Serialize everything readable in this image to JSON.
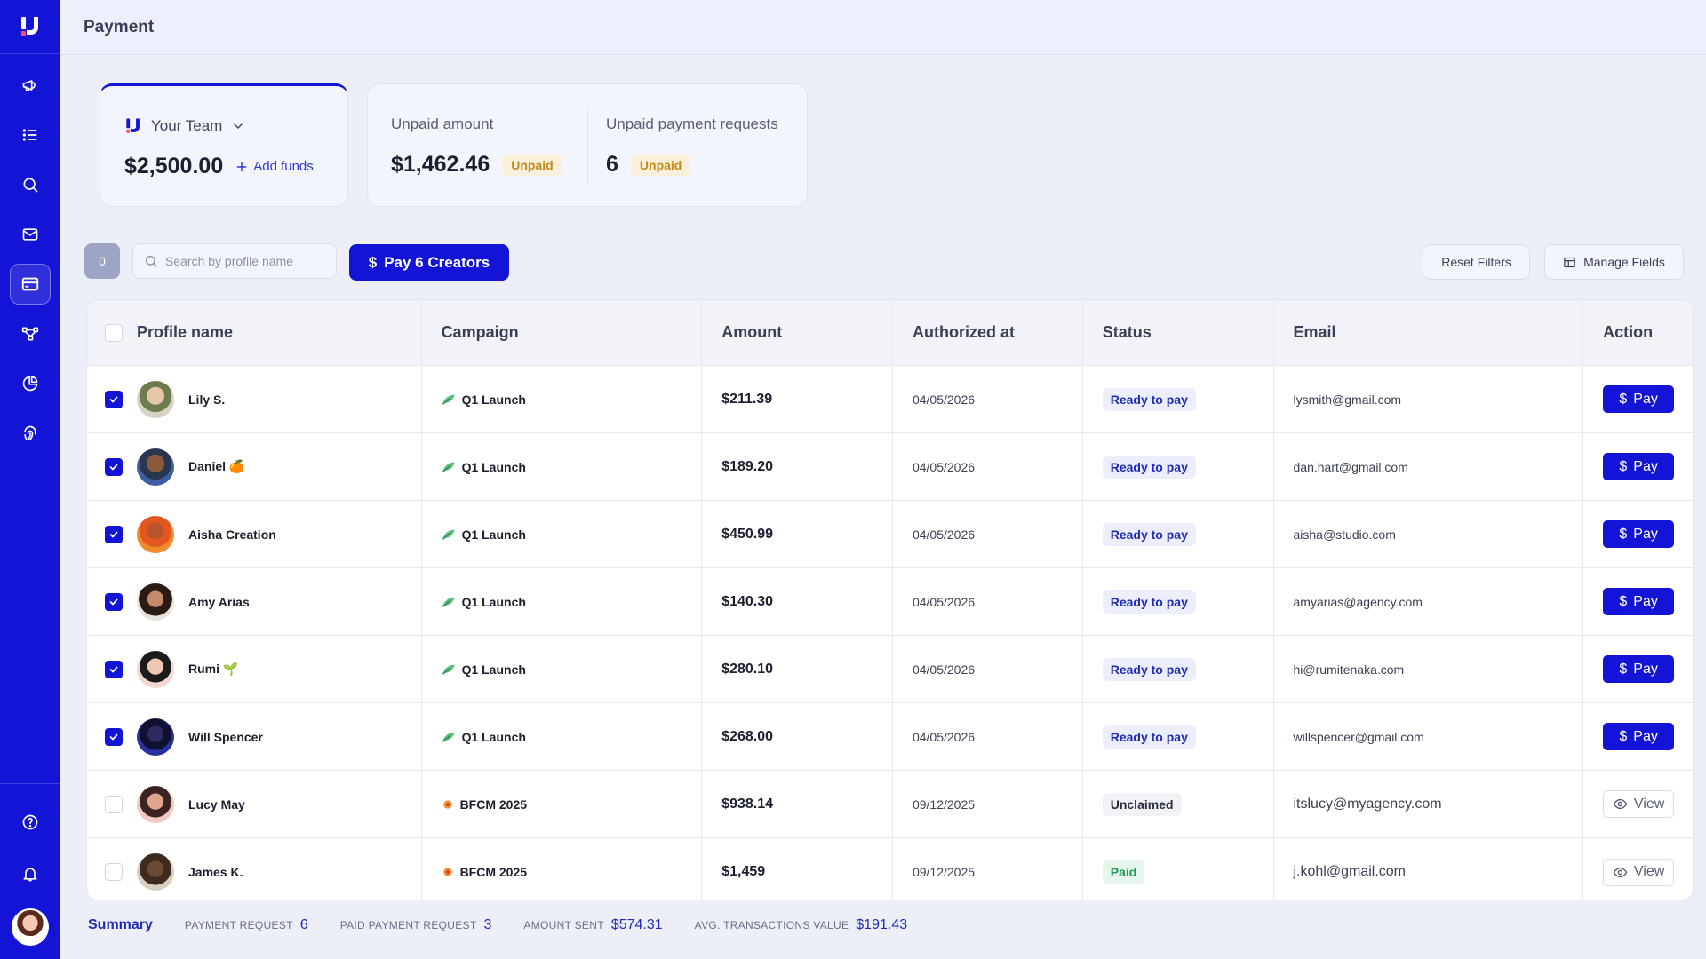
{
  "header": {
    "title": "Payment"
  },
  "team_card": {
    "team_name": "Your Team",
    "balance": "$2,500.00",
    "add_funds_label": "Add funds"
  },
  "unpaid_card": {
    "amount_label": "Unpaid amount",
    "amount_value": "$1,462.46",
    "amount_badge": "Unpaid",
    "requests_label": "Unpaid payment requests",
    "requests_value": "6",
    "requests_badge": "Unpaid"
  },
  "toolbar": {
    "selected_count": "0",
    "search_placeholder": "Search by profile name",
    "pay_button_label": "Pay 6 Creators",
    "reset_label": "Reset Filters",
    "manage_label": "Manage Fields"
  },
  "table": {
    "columns": [
      "Profile name",
      "Campaign",
      "Amount",
      "Authorized at",
      "Status",
      "Email",
      "Action"
    ],
    "rows": [
      {
        "name": "Lily S.",
        "emoji": "",
        "campaign": "Q1 Launch",
        "amount": "$211.39",
        "date": "04/05/2026",
        "status": "Ready to pay",
        "email": "lysmith@gmail.com",
        "action": "Pay",
        "checked": true
      },
      {
        "name": "Daniel",
        "emoji": "🍊",
        "campaign": "Q1 Launch",
        "amount": "$189.20",
        "date": "04/05/2026",
        "status": "Ready to pay",
        "email": "dan.hart@gmail.com",
        "action": "Pay",
        "checked": true
      },
      {
        "name": "Aisha Creation",
        "emoji": "",
        "campaign": "Q1 Launch",
        "amount": "$450.99",
        "date": "04/05/2026",
        "status": "Ready to pay",
        "email": "aisha@studio.com",
        "action": "Pay",
        "checked": true
      },
      {
        "name": "Amy Arias",
        "emoji": "",
        "campaign": "Q1 Launch",
        "amount": "$140.30",
        "date": "04/05/2026",
        "status": "Ready to pay",
        "email": "amyarias@agency.com",
        "action": "Pay",
        "checked": true
      },
      {
        "name": "Rumi",
        "emoji": "🌱",
        "campaign": "Q1 Launch",
        "amount": "$280.10",
        "date": "04/05/2026",
        "status": "Ready to pay",
        "email": "hi@rumitenaka.com",
        "action": "Pay",
        "checked": true
      },
      {
        "name": "Will Spencer",
        "emoji": "",
        "campaign": "Q1 Launch",
        "amount": "$268.00",
        "date": "04/05/2026",
        "status": "Ready to pay",
        "email": "willspencer@gmail.com",
        "action": "Pay",
        "checked": true
      },
      {
        "name": "Lucy May",
        "emoji": "",
        "campaign": "BFCM 2025",
        "amount": "$938.14",
        "date": "09/12/2025",
        "status": "Unclaimed",
        "email": "itslucy@myagency.com",
        "action": "View",
        "checked": false
      },
      {
        "name": "James K.",
        "emoji": "",
        "campaign": "BFCM 2025",
        "amount": "$1,459",
        "date": "09/12/2025",
        "status": "Paid",
        "email": "j.kohl@gmail.com",
        "action": "View",
        "checked": false
      }
    ]
  },
  "summary": {
    "title": "Summary",
    "payment_request_label": "PAYMENT REQUEST",
    "payment_request_value": "6",
    "paid_label": "PAID PAYMENT REQUEST",
    "paid_value": "3",
    "amount_sent_label": "AMOUNT SENT",
    "amount_sent_value": "$574.31",
    "avg_label": "AVG. TRANSACTIONS VALUE",
    "avg_value": "$191.43"
  },
  "icons": {
    "sidebar": [
      "megaphone-icon",
      "list-icon",
      "search-icon",
      "mail-icon",
      "credit-card-icon",
      "network-icon",
      "pie-chart-icon",
      "fingerprint-icon"
    ],
    "sidebar_bottom": [
      "help-icon",
      "bell-icon"
    ]
  },
  "colors": {
    "brand": "#1414d6",
    "unpaid": "#c48a16",
    "paid": "#1f9a55",
    "ready": "#1e2bb8"
  }
}
